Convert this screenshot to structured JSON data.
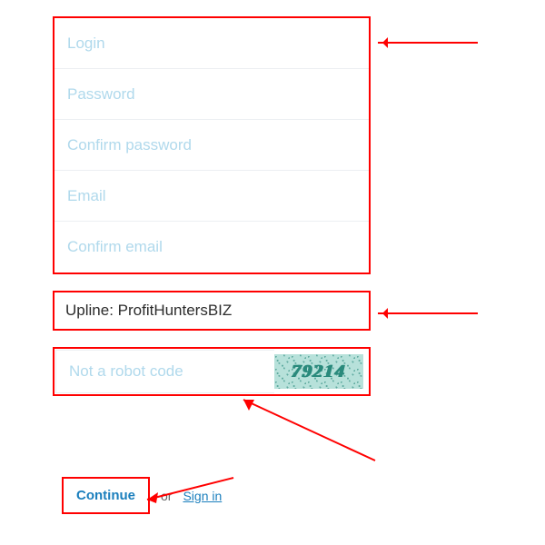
{
  "fields": {
    "login": {
      "placeholder": "Login"
    },
    "password": {
      "placeholder": "Password"
    },
    "confirm_password": {
      "placeholder": "Confirm password"
    },
    "email": {
      "placeholder": "Email"
    },
    "confirm_email": {
      "placeholder": "Confirm email"
    }
  },
  "upline": {
    "text": "Upline: ProfitHuntersBIZ"
  },
  "captcha": {
    "placeholder": "Not a robot code",
    "code": "79214"
  },
  "actions": {
    "continue": "Continue",
    "or": "or",
    "signin": "Sign in"
  }
}
